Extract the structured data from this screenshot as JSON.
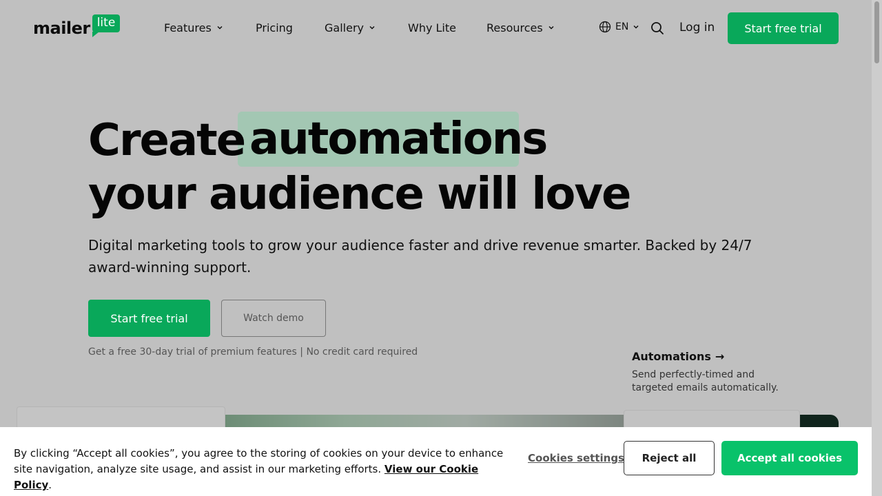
{
  "header": {
    "logo_word": "mailer",
    "logo_badge": "lite",
    "nav": [
      {
        "label": "Features",
        "has_dropdown": true
      },
      {
        "label": "Pricing",
        "has_dropdown": false
      },
      {
        "label": "Gallery",
        "has_dropdown": true
      },
      {
        "label": "Why Lite",
        "has_dropdown": false
      },
      {
        "label": "Resources",
        "has_dropdown": true
      }
    ],
    "language": "EN",
    "login_label": "Log in",
    "cta_label": "Start free trial"
  },
  "hero": {
    "title_start": "Create",
    "title_highlight": "automations",
    "title_end": "your audience will love",
    "subtitle": "Digital marketing tools to grow your audience faster and drive revenue smarter. Backed by 24/7 award-winning support.",
    "primary_cta": "Start free trial",
    "secondary_cta": "Watch demo",
    "trial_note": "Get a free 30-day trial of premium features | No credit card required"
  },
  "feature": {
    "title": "Automations",
    "arrow": "→",
    "description": "Send perfectly-timed and targeted emails automatically."
  },
  "cookie_banner": {
    "text": "By clicking “Accept all cookies”, you agree to the storing of cookies on your device to enhance site navigation, analyze site usage, and assist in our marketing efforts.",
    "policy_link": "View our Cookie Policy",
    "period": ".",
    "settings_label": "Cookies settings",
    "reject_label": "Reject all",
    "accept_label": "Accept all cookies"
  },
  "colors": {
    "brand_green": "#09a85a",
    "accept_green": "#09c26a",
    "highlight": "#a3c7b3",
    "overlay_bg": "#c0c0c0"
  },
  "icons": [
    "chevron-down-icon",
    "globe-icon",
    "search-icon",
    "arrow-right-icon"
  ]
}
